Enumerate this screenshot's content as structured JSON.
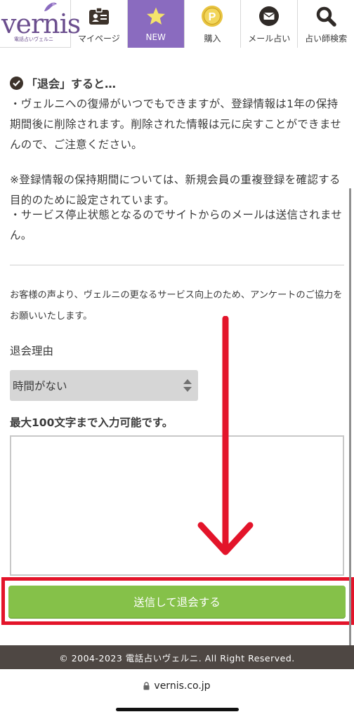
{
  "logo": {
    "text": "vernis",
    "sub": "電話占いヴェルニ"
  },
  "nav": [
    {
      "label": "マイページ",
      "icon": "id-card-icon"
    },
    {
      "label": "NEW",
      "icon": "star-icon"
    },
    {
      "label": "購入",
      "icon": "coin-icon"
    },
    {
      "label": "メール占い",
      "icon": "mail-icon"
    },
    {
      "label": "占い師検索",
      "icon": "search-icon"
    }
  ],
  "notice": {
    "title": "「退会」すると…",
    "p1": "・ヴェルニへの復帰がいつでもできますが、登録情報は1年の保持期間後に削除されます。削除された情報は元に戻すことができませんので、ご注意ください。",
    "p2": "※登録情報の保持期間については、新規会員の重複登録を確認する目的のために設定されています。",
    "p3": "・サービス停止状態となるのでサイトからのメールは送信されません。"
  },
  "survey": {
    "intro": "お客様の声より、ヴェルニの更なるサービス向上のため、アンケートのご協力をお願いいたします。",
    "reason_label": "退会理由",
    "reason_selected": "時間がない",
    "max_label": "最大100文字まで入力可能です。",
    "submit_label": "送信して退会する"
  },
  "footer": {
    "copyright": "© 2004-2023 電話占いヴェルニ. All Right Reserved."
  },
  "browser": {
    "url": "vernis.co.jp"
  },
  "colors": {
    "brand": "#6b4e8e",
    "active_tab": "#8a6bbf",
    "submit": "#85c149",
    "highlight": "#e3142a",
    "footer": "#4e4743"
  }
}
